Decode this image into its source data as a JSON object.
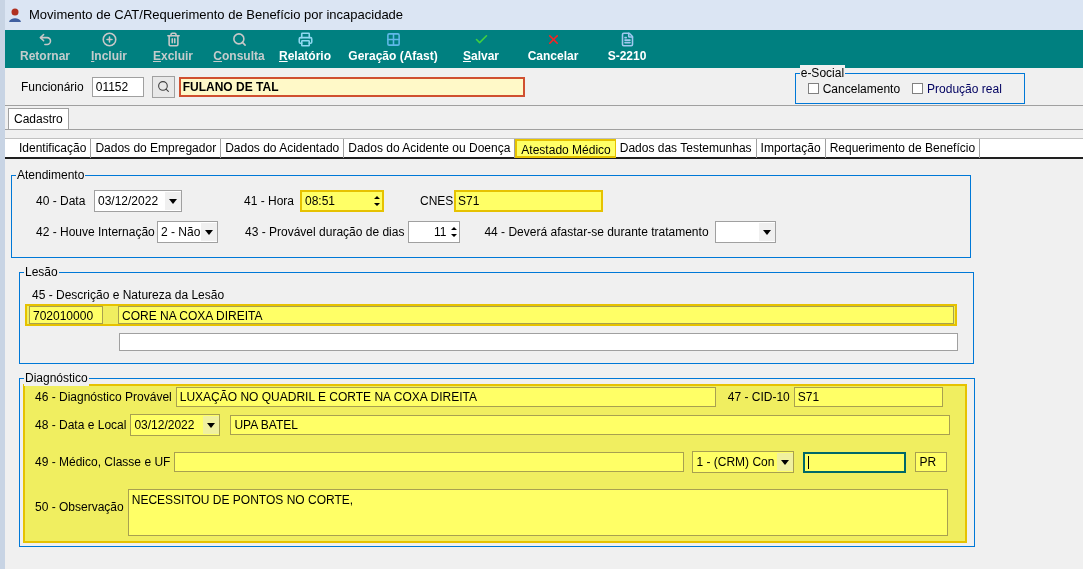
{
  "window": {
    "title": "Movimento de CAT/Requerimento de Benefício por incapacidade"
  },
  "toolbar": [
    {
      "label": "Retornar",
      "disabled": true,
      "accelerator": false
    },
    {
      "label": "Incluir",
      "disabled": true,
      "accelerator": true
    },
    {
      "label": "Excluir",
      "disabled": true,
      "accelerator": true
    },
    {
      "label": "Consulta",
      "disabled": true,
      "accelerator": true
    },
    {
      "label": "Relatório",
      "disabled": false,
      "accelerator": true
    },
    {
      "label": "Geração (Afast)",
      "disabled": false,
      "accelerator": false
    },
    {
      "label": "Salvar",
      "disabled": false,
      "accelerator": true
    },
    {
      "label": "Cancelar",
      "disabled": false,
      "accelerator": false
    },
    {
      "label": "S-2210",
      "disabled": false,
      "accelerator": false
    }
  ],
  "employee": {
    "label": "Funcionário",
    "code": "01152",
    "name": "FULANO DE TAL"
  },
  "esocial": {
    "title": "e-Social",
    "options": [
      {
        "label": "Cancelamento",
        "checked": false
      },
      {
        "label": "Produção real",
        "checked": false
      }
    ]
  },
  "main_tabs": [
    {
      "label": "Cadastro",
      "selected": true
    }
  ],
  "sub_tabs": [
    {
      "label": "Identificação",
      "selected": false
    },
    {
      "label": "Dados do Empregador",
      "selected": false
    },
    {
      "label": "Dados do Acidentado",
      "selected": false
    },
    {
      "label": "Dados do Acidente ou Doença",
      "selected": false
    },
    {
      "label": "Atestado Médico",
      "selected": true
    },
    {
      "label": "Dados das Testemunhas",
      "selected": false
    },
    {
      "label": "Importação",
      "selected": false
    },
    {
      "label": "Requerimento de Benefício",
      "selected": false
    }
  ],
  "atendimento": {
    "title": "Atendimento",
    "data": {
      "label": "40 - Data",
      "value": "03/12/2022",
      "highlighted": false
    },
    "hora": {
      "label": "41 - Hora",
      "value": "08:51",
      "highlighted": true
    },
    "cnes": {
      "label": "CNES",
      "value": "S71",
      "highlighted": true
    },
    "internacao": {
      "label": "42 - Houve Internação",
      "value": "2 - Não",
      "highlighted": false
    },
    "duracao": {
      "label": "43 - Provável duração de dias",
      "value": "11",
      "highlighted": false
    },
    "afastar": {
      "label": "44 - Deverá afastar-se durante tratamento",
      "highlighted": false
    }
  },
  "lesao": {
    "title": "Lesão",
    "label": "45 - Descrição e Natureza da Lesão",
    "highlighted": true,
    "code": "702010000",
    "description": "CORE NA COXA DIREITA"
  },
  "diagnostico": {
    "title": "Diagnóstico",
    "highlighted": true,
    "provavel": {
      "label": "46 - Diagnóstico Provável",
      "value": "LUXAÇÃO NO QUADRIL E CORTE NA COXA DIREITA"
    },
    "cid": {
      "label": "47 - CID-10",
      "value": "S71"
    },
    "data_local": {
      "label": "48 - Data e Local",
      "date": "03/12/2022",
      "place": "UPA BATEL"
    },
    "medico": {
      "label": "49 - Médico, Classe e UF",
      "class": "1 - (CRM)  Con",
      "registry_focused": true,
      "uf": "PR"
    },
    "observacao": {
      "label": "50 - Observação",
      "value": "NECESSITOU DE PONTOS NO CORTE,"
    }
  }
}
